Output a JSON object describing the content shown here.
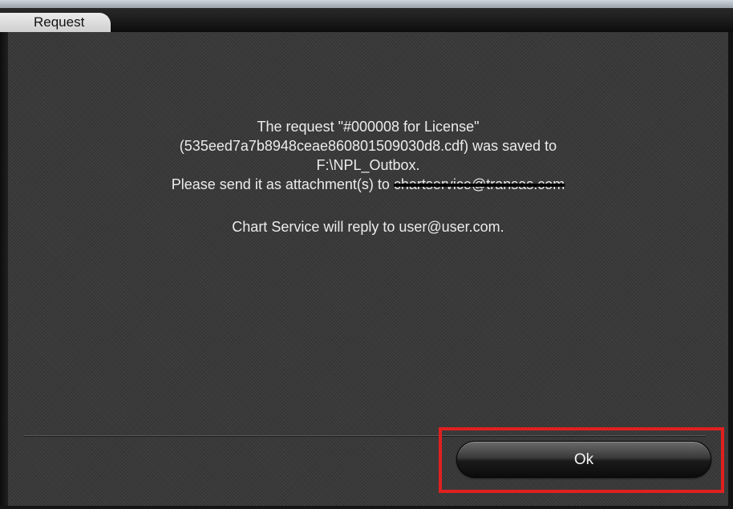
{
  "window": {
    "title": "Request"
  },
  "message": {
    "line1": "The request \"#000008 for License\"",
    "line2": "(535eed7a7b8948ceae860801509030d8.cdf) was saved to",
    "line3": "F:\\NPL_Outbox.",
    "line4_prefix": "Please send it as attachment(s) to",
    "line4_redacted_email": "chartservice@transas.com",
    "line5": "Chart Service will reply to user@user.com."
  },
  "buttons": {
    "ok_label": "Ok"
  },
  "colors": {
    "highlight_border": "#e02020",
    "background": "#3a3a3a",
    "text": "#ececec"
  }
}
